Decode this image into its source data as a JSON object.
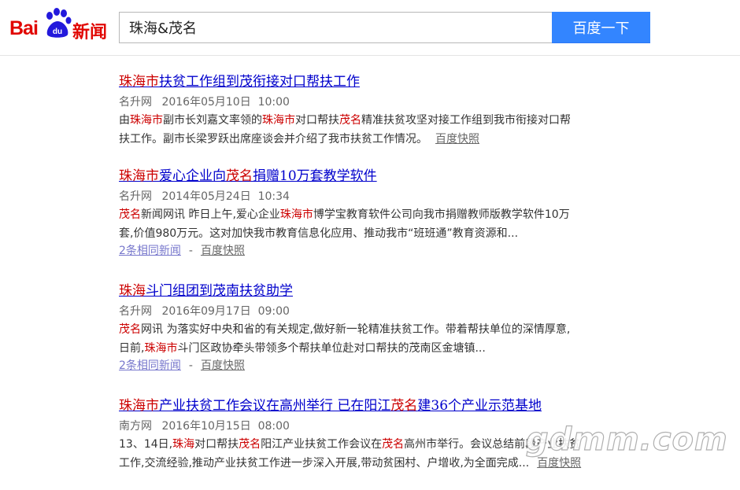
{
  "header": {
    "logo_text_left": "Bai",
    "logo_paw_text": "du",
    "logo_text_right": "新闻",
    "search_value": "珠海&茂名",
    "search_button": "百度一下"
  },
  "results": [
    {
      "title": [
        {
          "t": "珠海市",
          "hl": true
        },
        {
          "t": "扶贫工作组到茂衔接对口帮扶工作",
          "hl": false
        }
      ],
      "source": "名升网",
      "time": "2016年05月10日  10:00",
      "abstract_lines": [
        [
          {
            "t": "由",
            "hl": false
          },
          {
            "t": "珠海市",
            "hl": true
          },
          {
            "t": "副市长刘嘉文率领的",
            "hl": false
          },
          {
            "t": "珠海市",
            "hl": true
          },
          {
            "t": "对口帮扶",
            "hl": false
          },
          {
            "t": "茂名",
            "hl": true
          },
          {
            "t": "精准扶贫攻坚对接工作组到我市衔接对口帮",
            "hl": false
          }
        ],
        [
          {
            "t": "扶工作。副市长梁罗跃出席座谈会并介绍了我市扶贫工作情况。",
            "hl": false
          }
        ]
      ],
      "snapshot": "百度快照"
    },
    {
      "title": [
        {
          "t": "珠海市",
          "hl": true
        },
        {
          "t": "爱心企业向",
          "hl": false
        },
        {
          "t": "茂名",
          "hl": true
        },
        {
          "t": "捐赠10万套教学软件",
          "hl": false
        }
      ],
      "source": "名升网",
      "time": "2014年05月24日  10:34",
      "abstract_lines": [
        [
          {
            "t": "茂名",
            "hl": true
          },
          {
            "t": "新闻网讯 昨日上午,爱心企业",
            "hl": false
          },
          {
            "t": "珠海市",
            "hl": true
          },
          {
            "t": "博学宝教育软件公司向我市捐赠教师版教学软件10万",
            "hl": false
          }
        ],
        [
          {
            "t": "套,价值980万元。这对加快我市教育信息化应用、推动我市“班班通”教育资源和...",
            "hl": false
          }
        ]
      ],
      "same_news": "2条相同新闻",
      "separator": "-",
      "snapshot": "百度快照"
    },
    {
      "title": [
        {
          "t": "珠海",
          "hl": true
        },
        {
          "t": "斗门组团到茂南扶贫助学",
          "hl": false
        }
      ],
      "source": "名升网",
      "time": "2016年09月17日  09:00",
      "abstract_lines": [
        [
          {
            "t": "茂名",
            "hl": true
          },
          {
            "t": "网讯 为落实好中央和省的有关规定,做好新一轮精准扶贫工作。带着帮扶单位的深情厚意,",
            "hl": false
          }
        ],
        [
          {
            "t": "日前,",
            "hl": false
          },
          {
            "t": "珠海市",
            "hl": true
          },
          {
            "t": "斗门区政协牵头带领多个帮扶单位赴对口帮扶的茂南区金塘镇...",
            "hl": false
          }
        ]
      ],
      "same_news": "2条相同新闻",
      "separator": "-",
      "snapshot": "百度快照"
    },
    {
      "title": [
        {
          "t": "珠海市",
          "hl": true
        },
        {
          "t": "产业扶贫工作会议在高州举行 已在阳江",
          "hl": false
        },
        {
          "t": "茂名",
          "hl": true
        },
        {
          "t": "建36个产业示范基地",
          "hl": false
        }
      ],
      "source": "南方网",
      "time": "2016年10月15日  08:00",
      "abstract_lines": [
        [
          {
            "t": "13、14日,",
            "hl": false
          },
          {
            "t": "珠海",
            "hl": true
          },
          {
            "t": "对口帮扶",
            "hl": false
          },
          {
            "t": "茂名",
            "hl": true
          },
          {
            "t": "阳江产业扶贫工作会议在",
            "hl": false
          },
          {
            "t": "茂名",
            "hl": true
          },
          {
            "t": "高州市举行。会议总结前段产业扶贫",
            "hl": false
          }
        ],
        [
          {
            "t": "工作,交流经验,推动产业扶贫工作进一步深入开展,带动贫困村、户增收,为全面完成...",
            "hl": false
          }
        ]
      ],
      "snapshot": "百度快照"
    }
  ],
  "watermark": "gdmm.com"
}
